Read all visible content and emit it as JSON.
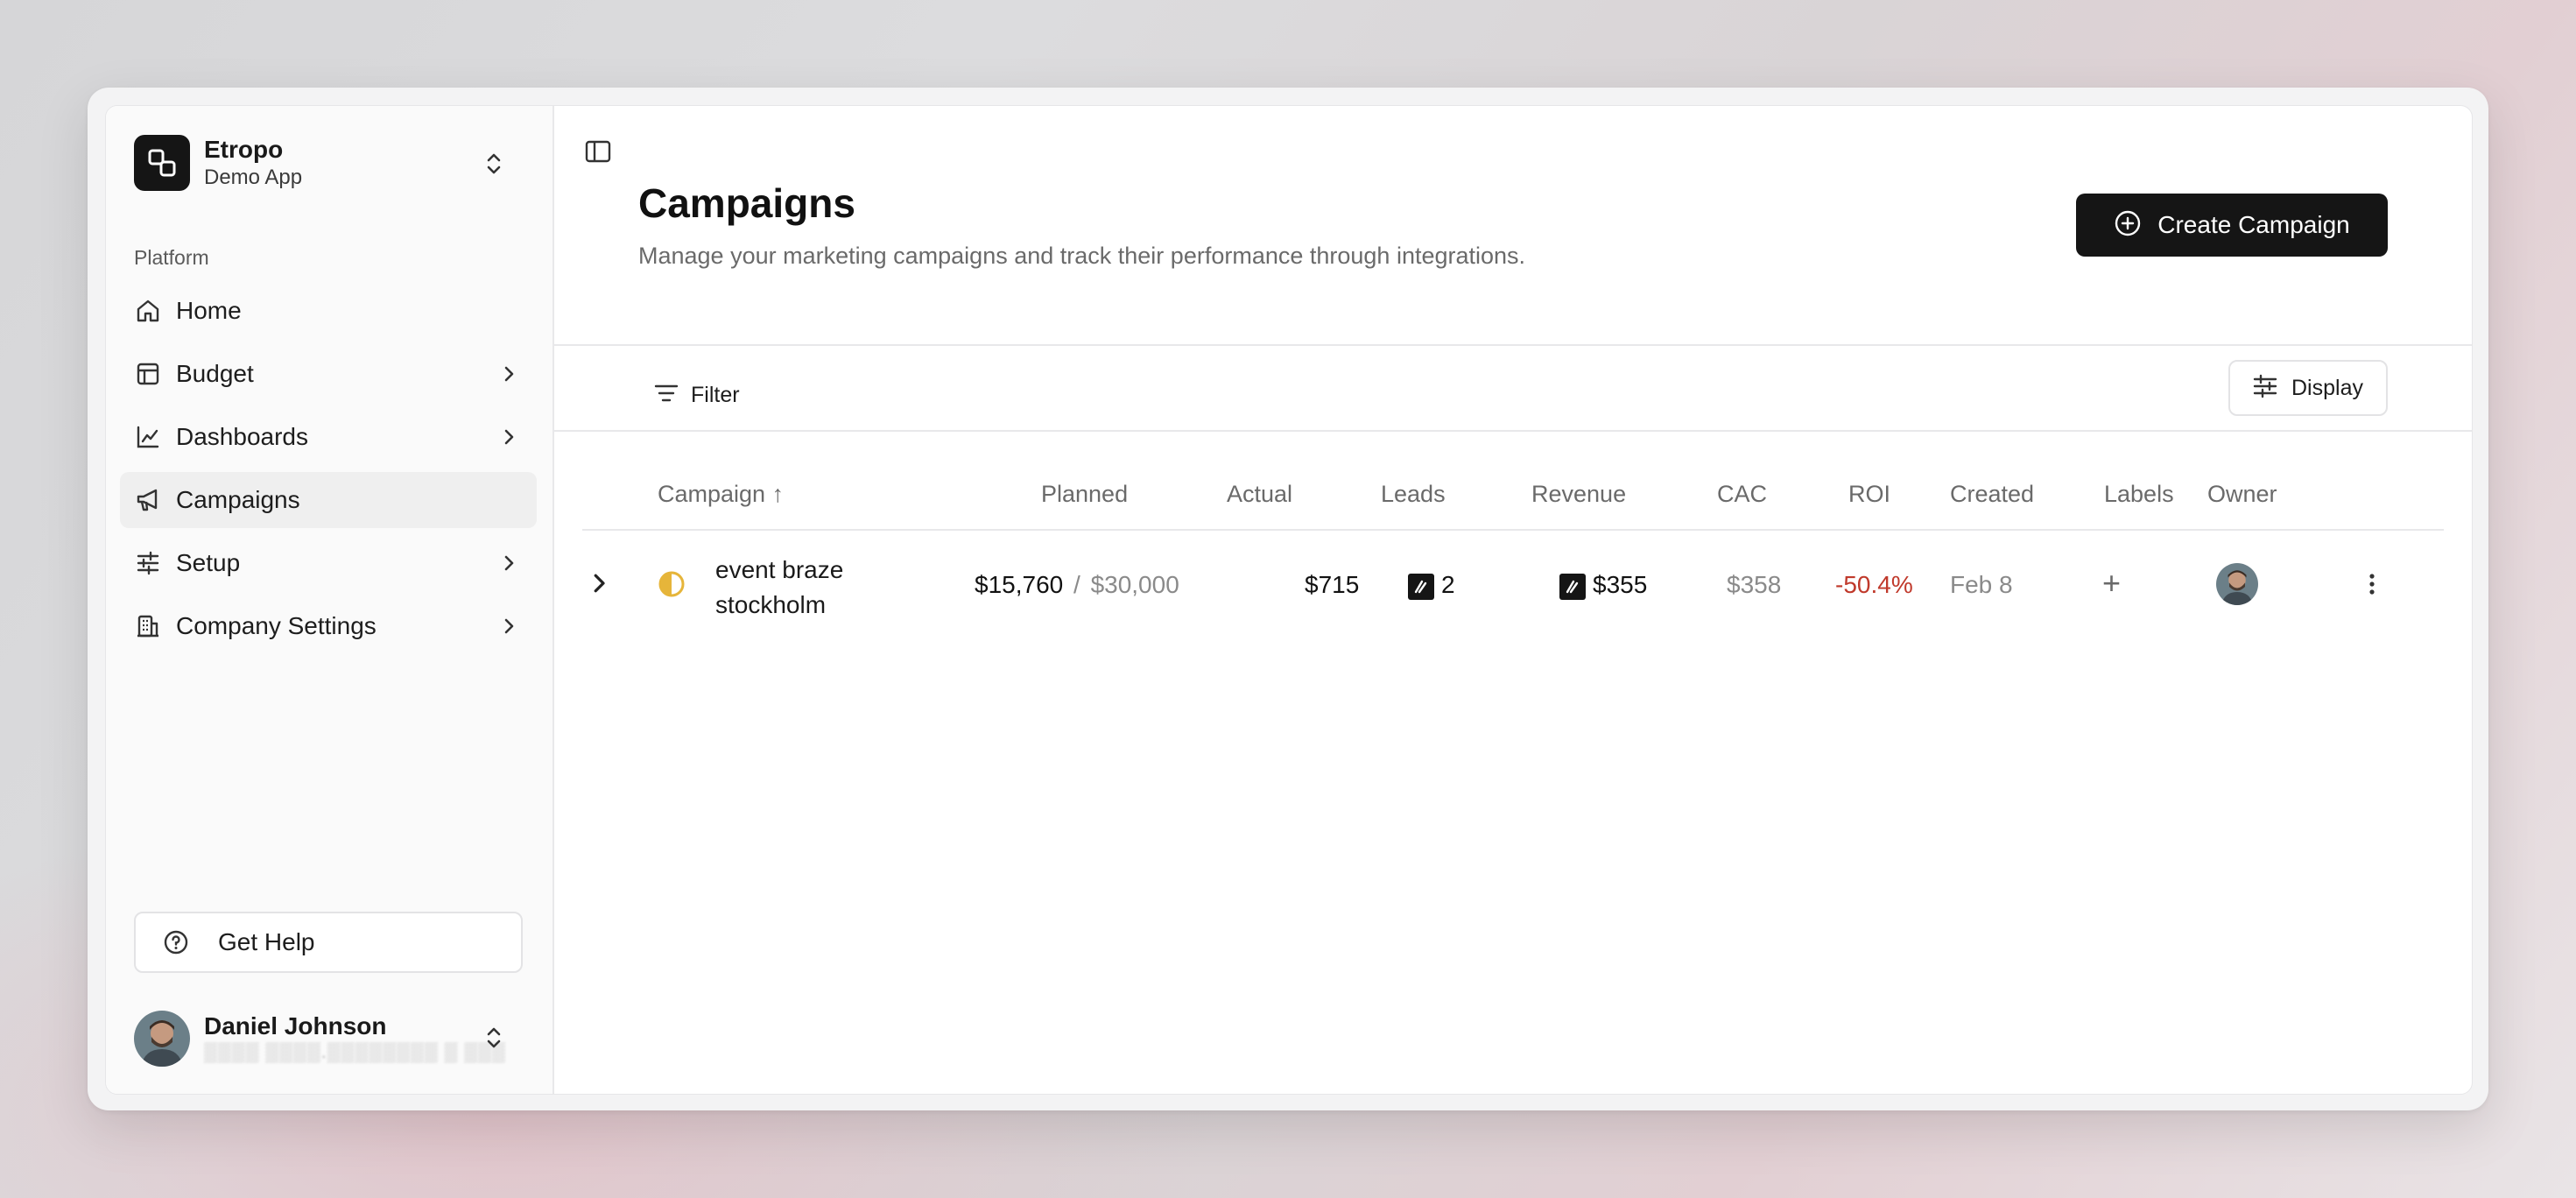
{
  "brand": {
    "name": "Etropo",
    "subtitle": "Demo App"
  },
  "sidebar": {
    "section_label": "Platform",
    "items": [
      {
        "label": "Home",
        "icon": "home-icon",
        "has_children": false,
        "active": false
      },
      {
        "label": "Budget",
        "icon": "table-icon",
        "has_children": true,
        "active": false
      },
      {
        "label": "Dashboards",
        "icon": "chart-line-icon",
        "has_children": true,
        "active": false
      },
      {
        "label": "Campaigns",
        "icon": "megaphone-icon",
        "has_children": false,
        "active": true
      },
      {
        "label": "Setup",
        "icon": "sliders-icon",
        "has_children": true,
        "active": false
      },
      {
        "label": "Company Settings",
        "icon": "building-icon",
        "has_children": true,
        "active": false
      }
    ],
    "help_label": "Get Help",
    "user": {
      "name": "Daniel Johnson"
    }
  },
  "header": {
    "title": "Campaigns",
    "subtitle": "Manage your marketing campaigns and track their performance through integrations.",
    "create_label": "Create Campaign"
  },
  "toolbar": {
    "filter_label": "Filter",
    "display_label": "Display"
  },
  "table": {
    "columns": [
      "Campaign",
      "Planned",
      "Actual",
      "Leads",
      "Revenue",
      "CAC",
      "ROI",
      "Created",
      "Labels",
      "Owner"
    ],
    "sort_indicator": "↑",
    "rows": [
      {
        "name_line1": "event braze",
        "name_line2": "stockholm",
        "planned_spent": "$15,760",
        "planned_sep": "/",
        "planned_total": "$30,000",
        "actual": "$715",
        "leads": "2",
        "revenue": "$355",
        "cac": "$358",
        "roi": "-50.4%",
        "created": "Feb 8",
        "labels_add": "+"
      }
    ]
  },
  "colors": {
    "accent": "#151515",
    "roi_negative": "#c0392b",
    "status_half": "#e6b53a"
  }
}
